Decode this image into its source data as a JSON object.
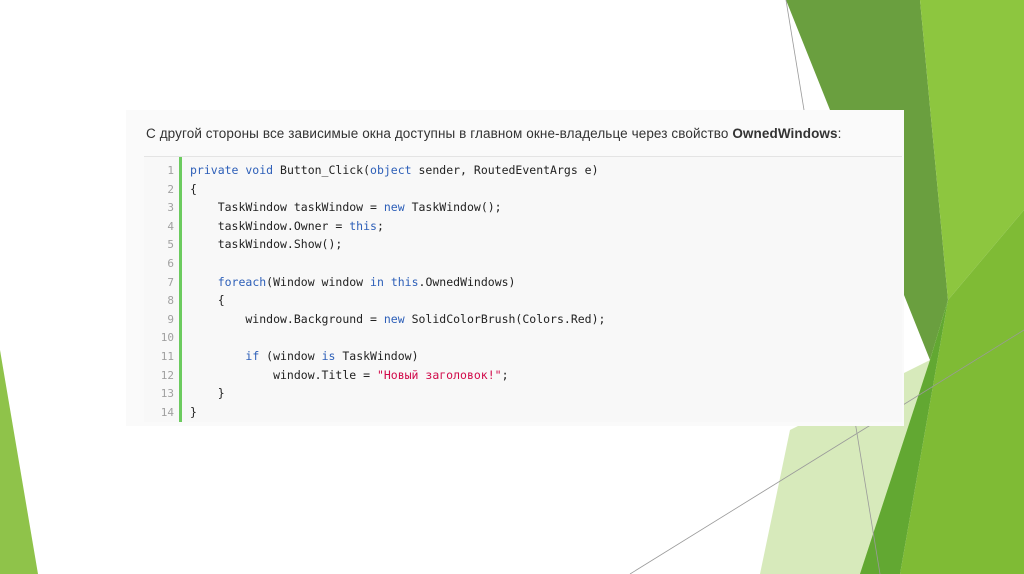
{
  "slide": {
    "intro_text_prefix": "С другой стороны все зависимые окна доступны в главном окне-владельце через свойство ",
    "intro_text_property": "OwnedWindows",
    "intro_text_suffix": ":"
  },
  "code": {
    "line_numbers": [
      "1",
      "2",
      "3",
      "4",
      "5",
      "6",
      "7",
      "8",
      "9",
      "10",
      "11",
      "12",
      "13",
      "14"
    ],
    "lines": [
      [
        {
          "t": "private void",
          "c": "kw"
        },
        {
          "t": " Button_Click(",
          "c": ""
        },
        {
          "t": "object",
          "c": "kw"
        },
        {
          "t": " sender, RoutedEventArgs e)",
          "c": ""
        }
      ],
      [
        {
          "t": "{",
          "c": ""
        }
      ],
      [
        {
          "t": "    TaskWindow taskWindow = ",
          "c": ""
        },
        {
          "t": "new",
          "c": "kw"
        },
        {
          "t": " TaskWindow();",
          "c": ""
        }
      ],
      [
        {
          "t": "    taskWindow.Owner = ",
          "c": ""
        },
        {
          "t": "this",
          "c": "kw"
        },
        {
          "t": ";",
          "c": ""
        }
      ],
      [
        {
          "t": "    taskWindow.Show();",
          "c": ""
        }
      ],
      [],
      [
        {
          "t": "    ",
          "c": ""
        },
        {
          "t": "foreach",
          "c": "kw"
        },
        {
          "t": "(Window window ",
          "c": ""
        },
        {
          "t": "in",
          "c": "kw"
        },
        {
          "t": " ",
          "c": ""
        },
        {
          "t": "this",
          "c": "kw"
        },
        {
          "t": ".OwnedWindows)",
          "c": ""
        }
      ],
      [
        {
          "t": "    {",
          "c": ""
        }
      ],
      [
        {
          "t": "        window.Background = ",
          "c": ""
        },
        {
          "t": "new",
          "c": "kw"
        },
        {
          "t": " SolidColorBrush(Colors.Red);",
          "c": ""
        }
      ],
      [],
      [
        {
          "t": "        ",
          "c": ""
        },
        {
          "t": "if",
          "c": "kw"
        },
        {
          "t": " (window ",
          "c": ""
        },
        {
          "t": "is",
          "c": "kw"
        },
        {
          "t": " TaskWindow)",
          "c": ""
        }
      ],
      [
        {
          "t": "            window.Title = ",
          "c": ""
        },
        {
          "t": "\"Новый заголовок!\"",
          "c": "str"
        },
        {
          "t": ";",
          "c": ""
        }
      ],
      [
        {
          "t": "    }",
          "c": ""
        }
      ],
      [
        {
          "t": "}",
          "c": ""
        }
      ]
    ]
  },
  "colors": {
    "keyword": "#2d5fb8",
    "string": "#d10a4a",
    "gutter_accent": "#6ccb5f",
    "green_dark": "#5b9a2e",
    "green_mid": "#7cb342",
    "green_light": "#a8d46f"
  }
}
